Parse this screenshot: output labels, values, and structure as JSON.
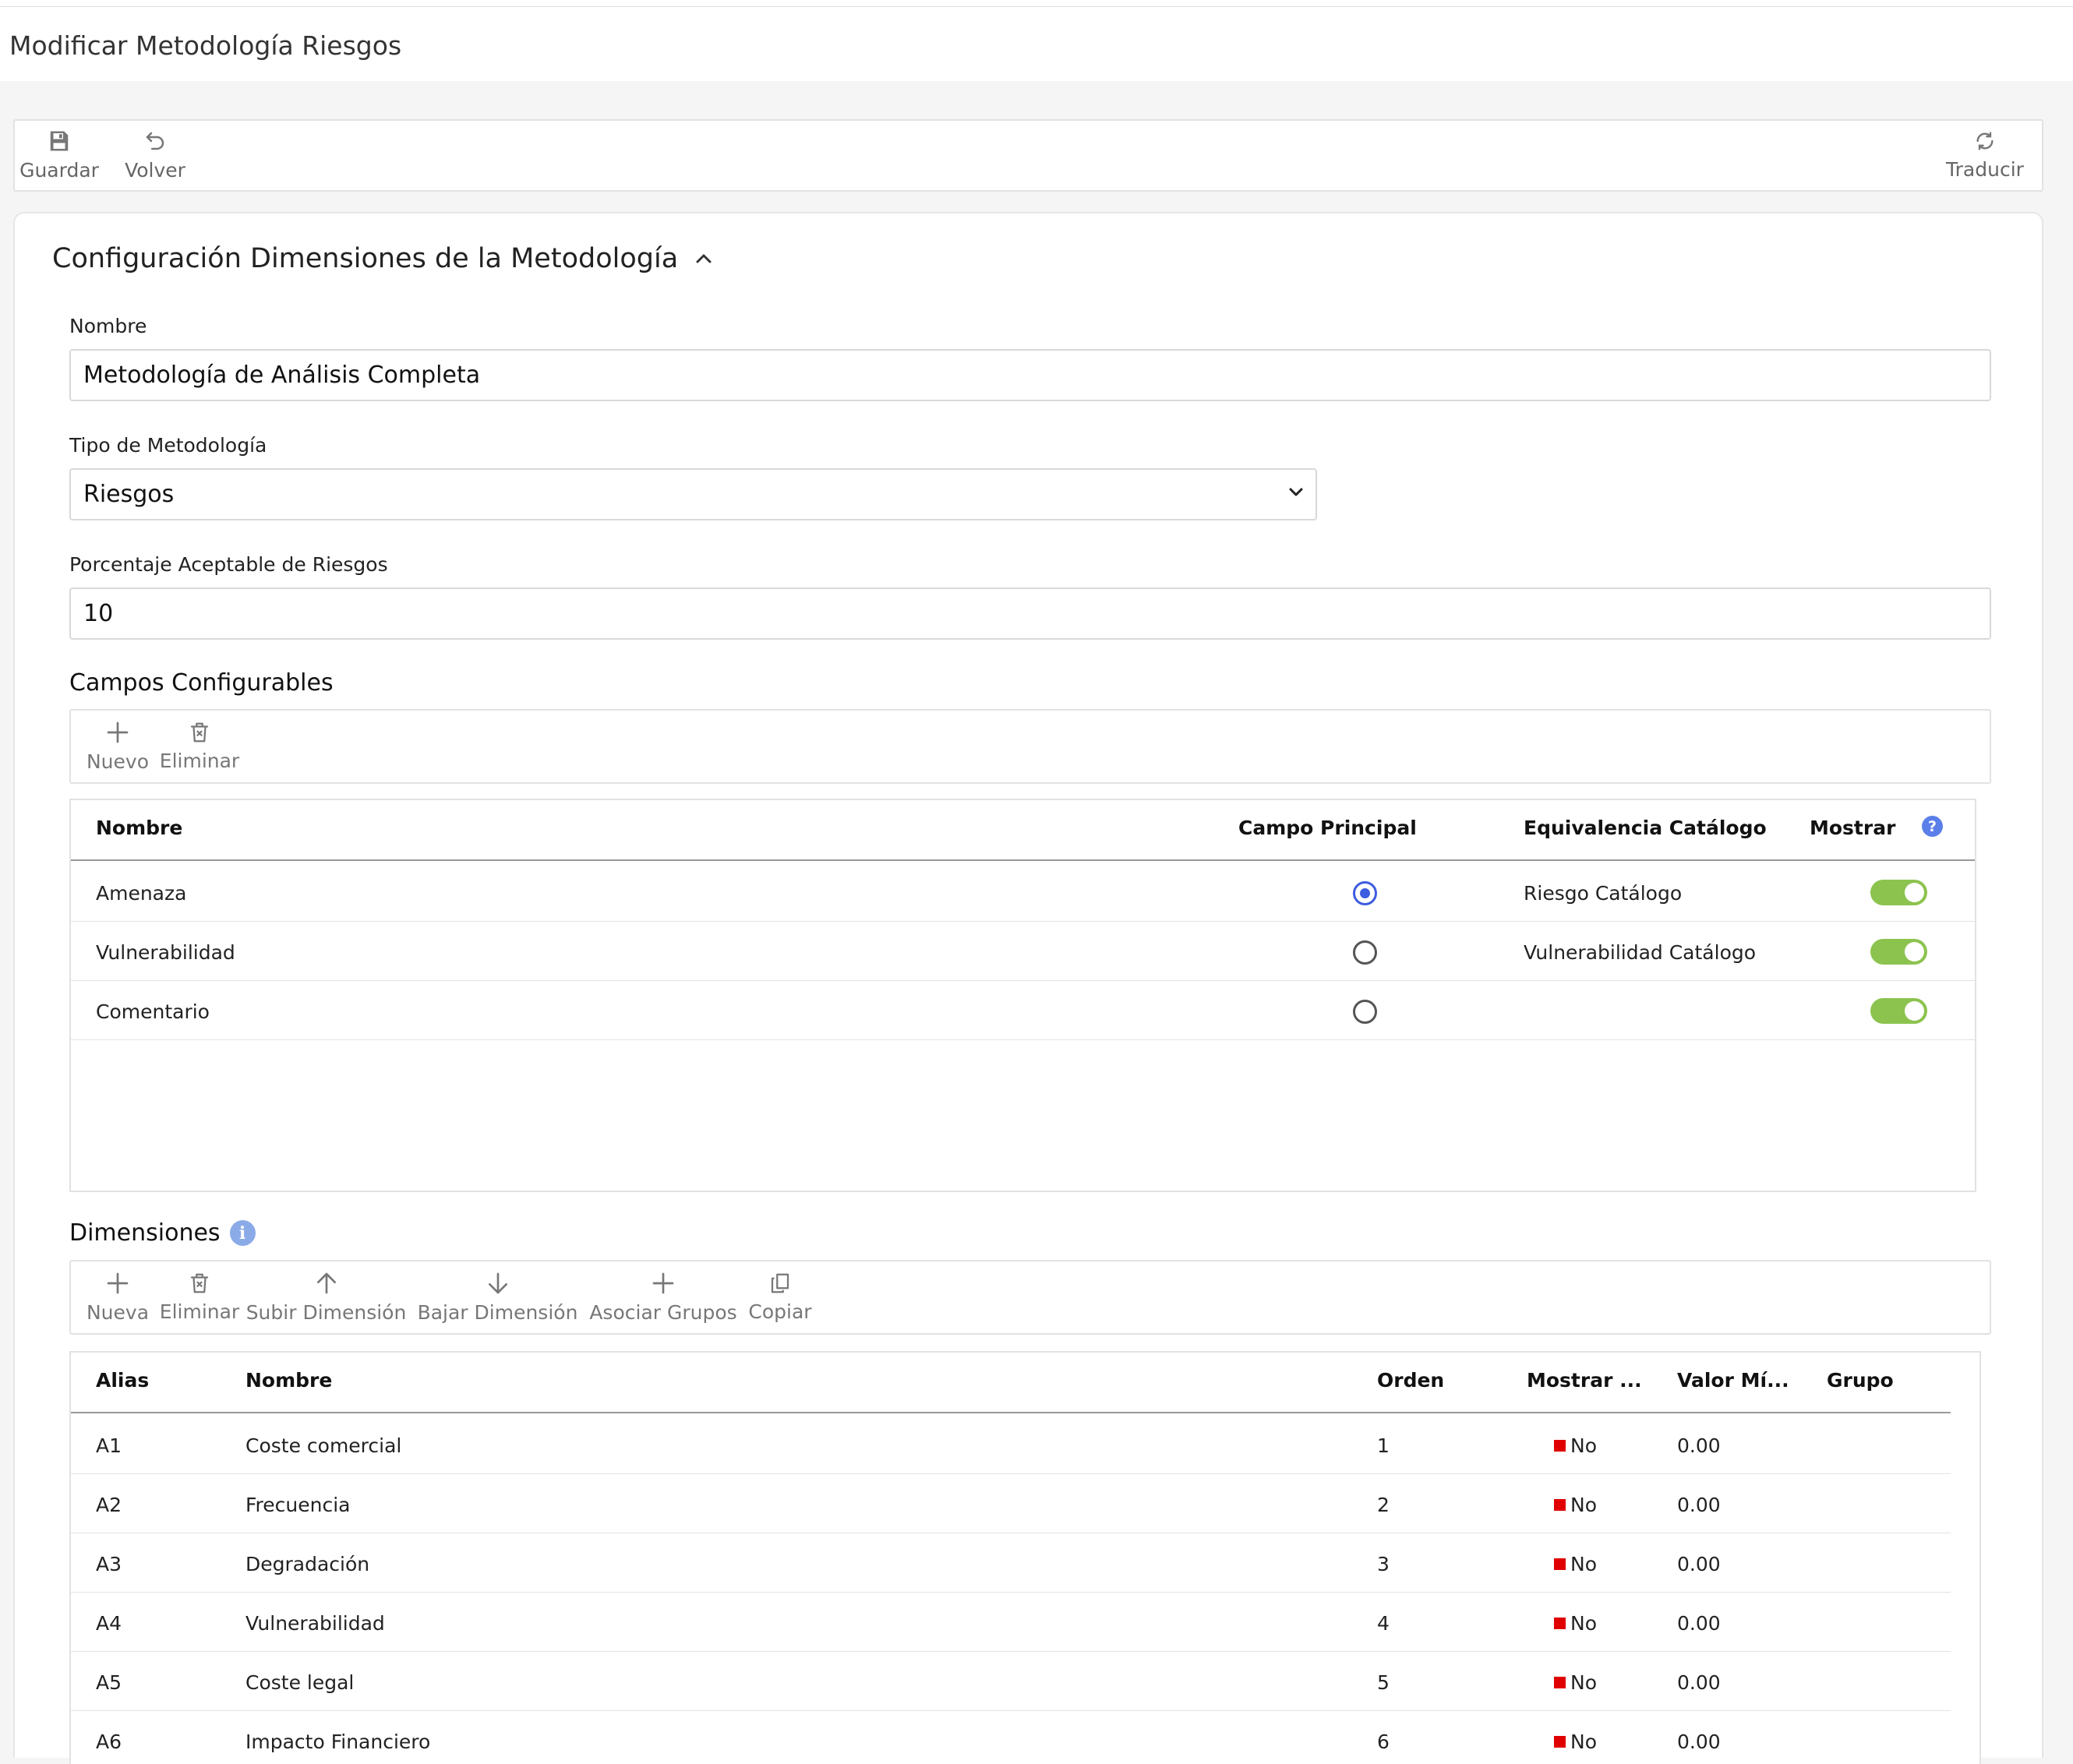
{
  "page": {
    "title": "Modificar Metodología Riesgos"
  },
  "toolbar": {
    "save": "Guardar",
    "back": "Volver",
    "translate": "Traducir"
  },
  "section": {
    "title": "Configuración Dimensiones de la Metodología"
  },
  "form": {
    "name_label": "Nombre",
    "name_value": "Metodología de Análisis Completa",
    "type_label": "Tipo de Metodología",
    "type_value": "Riesgos",
    "percent_label": "Porcentaje Aceptable de Riesgos",
    "percent_value": "10"
  },
  "campos": {
    "title": "Campos Configurables",
    "toolbar": {
      "new": "Nuevo",
      "delete": "Eliminar"
    },
    "columns": {
      "nombre": "Nombre",
      "principal": "Campo Principal",
      "equivalencia": "Equivalencia Catálogo",
      "mostrar": "Mostrar",
      "help": "?"
    },
    "rows": [
      {
        "nombre": "Amenaza",
        "principal": true,
        "equivalencia": "Riesgo Catálogo",
        "mostrar": true
      },
      {
        "nombre": "Vulnerabilidad",
        "principal": false,
        "equivalencia": "Vulnerabilidad Catálogo",
        "mostrar": true
      },
      {
        "nombre": "Comentario",
        "principal": false,
        "equivalencia": "",
        "mostrar": true
      }
    ]
  },
  "dimensiones": {
    "title": "Dimensiones",
    "info": "i",
    "toolbar": {
      "new": "Nueva",
      "delete": "Eliminar",
      "up": "Subir Dimensión",
      "down": "Bajar Dimensión",
      "groups": "Asociar Grupos",
      "copy": "Copiar"
    },
    "columns": {
      "alias": "Alias",
      "nombre": "Nombre",
      "orden": "Orden",
      "mostrar": "Mostrar ...",
      "valor": "Valor Mí...",
      "grupo": "Grupo"
    },
    "rows": [
      {
        "alias": "A1",
        "nombre": "Coste comercial",
        "orden": "1",
        "mostrar": "No",
        "valor": "0.00",
        "grupo": ""
      },
      {
        "alias": "A2",
        "nombre": "Frecuencia",
        "orden": "2",
        "mostrar": "No",
        "valor": "0.00",
        "grupo": ""
      },
      {
        "alias": "A3",
        "nombre": "Degradación",
        "orden": "3",
        "mostrar": "No",
        "valor": "0.00",
        "grupo": ""
      },
      {
        "alias": "A4",
        "nombre": "Vulnerabilidad",
        "orden": "4",
        "mostrar": "No",
        "valor": "0.00",
        "grupo": ""
      },
      {
        "alias": "A5",
        "nombre": "Coste legal",
        "orden": "5",
        "mostrar": "No",
        "valor": "0.00",
        "grupo": ""
      },
      {
        "alias": "A6",
        "nombre": "Impacto Financiero",
        "orden": "6",
        "mostrar": "No",
        "valor": "0.00",
        "grupo": ""
      }
    ]
  },
  "colors": {
    "accent": "#3d5ce0",
    "toggle_on": "#8cc34f",
    "status_no": "#e00000",
    "help_badge": "#5b7fe8"
  },
  "icons": [
    "save-icon",
    "undo-icon",
    "refresh-icon",
    "chevron-up-icon",
    "chevron-down-icon",
    "plus-icon",
    "trash-icon",
    "arrow-up-icon",
    "arrow-down-icon",
    "copy-icon",
    "help-icon",
    "info-icon"
  ]
}
